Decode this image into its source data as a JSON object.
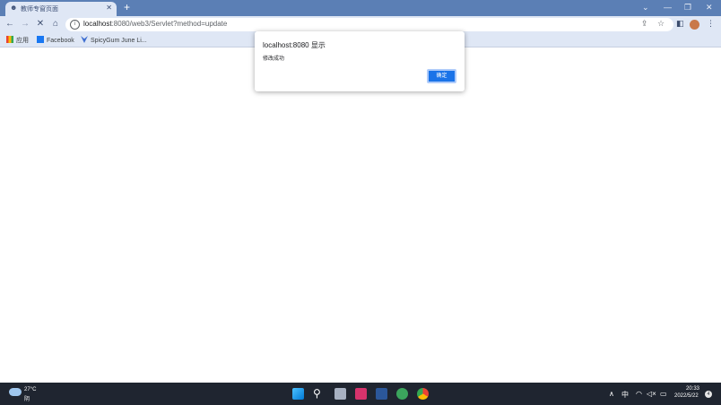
{
  "tab": {
    "title": "教师专窗页面",
    "favicon": "person-icon"
  },
  "toolbar": {
    "url_host": "localhost",
    "url_rest": ":8080/web3/Servlet?method=update"
  },
  "bookmarks": [
    {
      "label": "应用",
      "icon": "apps-icon"
    },
    {
      "label": "Facebook",
      "icon": "facebook-icon"
    },
    {
      "label": "SpicyGum June Li...",
      "icon": "bookmark-logo-icon"
    }
  ],
  "dialog": {
    "title": "localhost:8080 显示",
    "message": "修改成功",
    "ok_label": "确定"
  },
  "taskbar": {
    "weather_temp": "27°C",
    "weather_cond": "阴",
    "ime": "中",
    "time": "20:33",
    "date": "2022/5/22",
    "notification_count": "4"
  },
  "colors": {
    "tabstrip": "#5b7fb5",
    "toolbar": "#dfe7f5",
    "accent": "#1a73e8",
    "taskbar": "#1f2530"
  }
}
